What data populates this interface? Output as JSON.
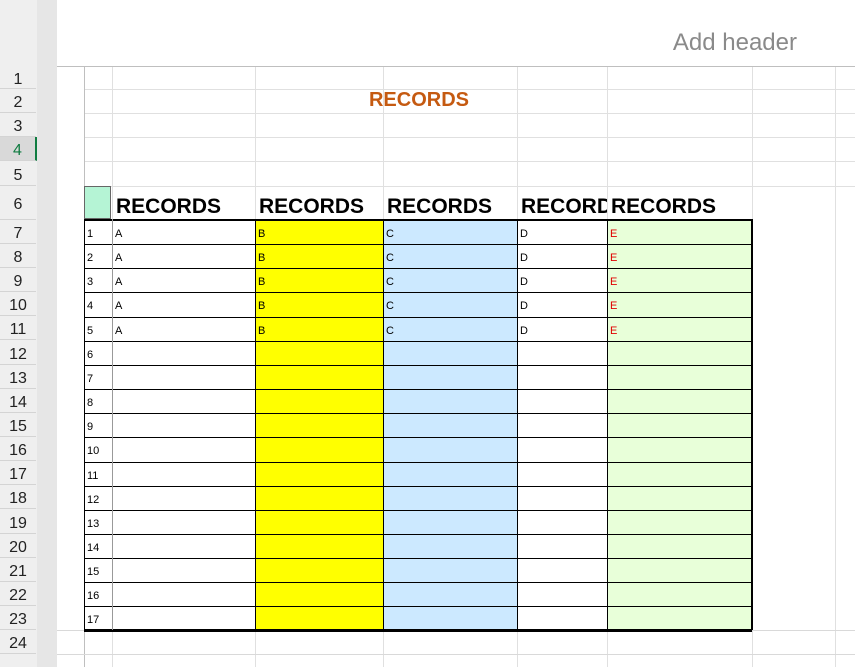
{
  "page": {
    "add_header": "Add header",
    "title": "RECORDS"
  },
  "row_numbers": [
    "1",
    "2",
    "3",
    "4",
    "5",
    "6",
    "7",
    "8",
    "9",
    "10",
    "11",
    "12",
    "13",
    "14",
    "15",
    "16",
    "17",
    "18",
    "19",
    "20",
    "21",
    "22",
    "23",
    "24"
  ],
  "selected_row": "4",
  "table": {
    "headers": [
      "RECORDS",
      "RECORDS",
      "RECORDS",
      "RECORDS",
      "RECORDS"
    ],
    "rows": [
      [
        "1",
        "A",
        "B",
        "C",
        "D",
        "E"
      ],
      [
        "2",
        "A",
        "B",
        "C",
        "D",
        "E"
      ],
      [
        "3",
        "A",
        "B",
        "C",
        "D",
        "E"
      ],
      [
        "4",
        "A",
        "B",
        "C",
        "D",
        "E"
      ],
      [
        "5",
        "A",
        "B",
        "C",
        "D",
        "E"
      ],
      [
        "6",
        "",
        "",
        "",
        "",
        ""
      ],
      [
        "7",
        "",
        "",
        "",
        "",
        ""
      ],
      [
        "8",
        "",
        "",
        "",
        "",
        ""
      ],
      [
        "9",
        "",
        "",
        "",
        "",
        ""
      ],
      [
        "10",
        "",
        "",
        "",
        "",
        ""
      ],
      [
        "11",
        "",
        "",
        "",
        "",
        ""
      ],
      [
        "12",
        "",
        "",
        "",
        "",
        ""
      ],
      [
        "13",
        "",
        "",
        "",
        "",
        ""
      ],
      [
        "14",
        "",
        "",
        "",
        "",
        ""
      ],
      [
        "15",
        "",
        "",
        "",
        "",
        ""
      ],
      [
        "16",
        "",
        "",
        "",
        "",
        ""
      ],
      [
        "17",
        "",
        "",
        "",
        "",
        ""
      ]
    ]
  },
  "colors": {
    "title": "#c55a11",
    "col_b_fill": "#ffff00",
    "col_c_fill": "#cce9ff",
    "col_e_fill": "#e8ffd9",
    "col_e_text": "#e00000",
    "selection": "#107c41"
  }
}
